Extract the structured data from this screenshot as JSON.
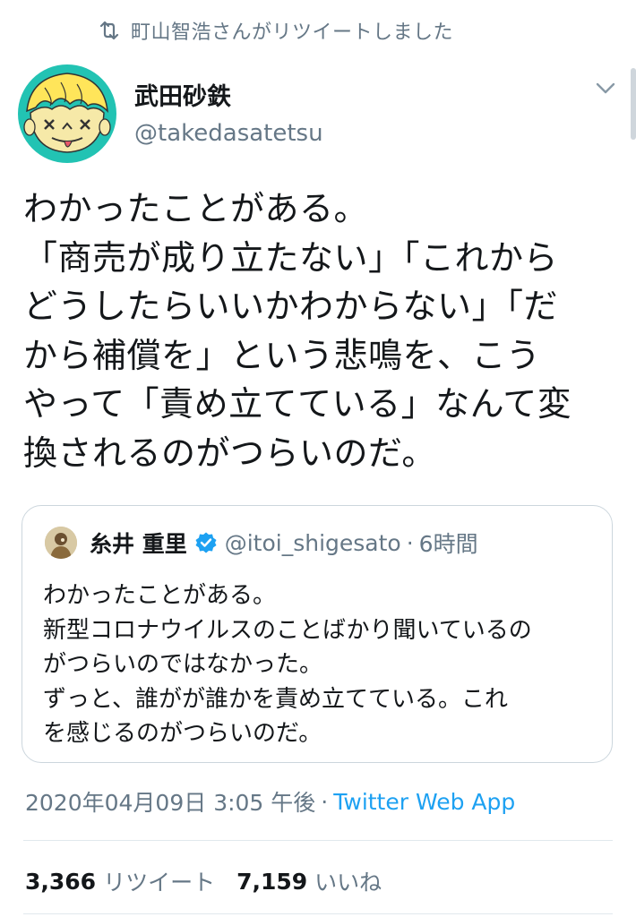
{
  "retweet_banner": {
    "text": "町山智浩さんがリツイートしました",
    "icon": "retweet-icon"
  },
  "tweet": {
    "author_name": "武田砂鉄",
    "author_handle": "@takedasatetsu",
    "text_lines": [
      "わかったことがある。",
      "「商売が成り立たない」「これから",
      "どうしたらいいかわからない」「だ",
      "から補償を」という悲鳴を、こう",
      "やって「責め立てている」なんて変",
      "換されるのがつらいのだ。"
    ],
    "quoted": {
      "name": "糸井 重里",
      "verified": true,
      "handle": "@itoi_shigesato",
      "separator": "·",
      "time": "6時間",
      "text_lines": [
        "わかったことがある。",
        "新型コロナウイルスのことばかり聞いているの",
        "がつらいのではなかった。",
        "ずっと、誰がが誰かを責め立てている。これ",
        "を感じるのがつらいのだ。"
      ]
    },
    "timestamp": "2020年04月09日 3:05 午後",
    "separator": "·",
    "source": "Twitter Web App",
    "stats": {
      "retweets_count": "3,366",
      "retweets_label": "リツイート",
      "likes_count": "7,159",
      "likes_label": "いいね"
    }
  },
  "colors": {
    "text": "#14171a",
    "secondary": "#657786",
    "link": "#1da1f2",
    "border": "#ccd6dd",
    "verified": "#1da1f2"
  }
}
